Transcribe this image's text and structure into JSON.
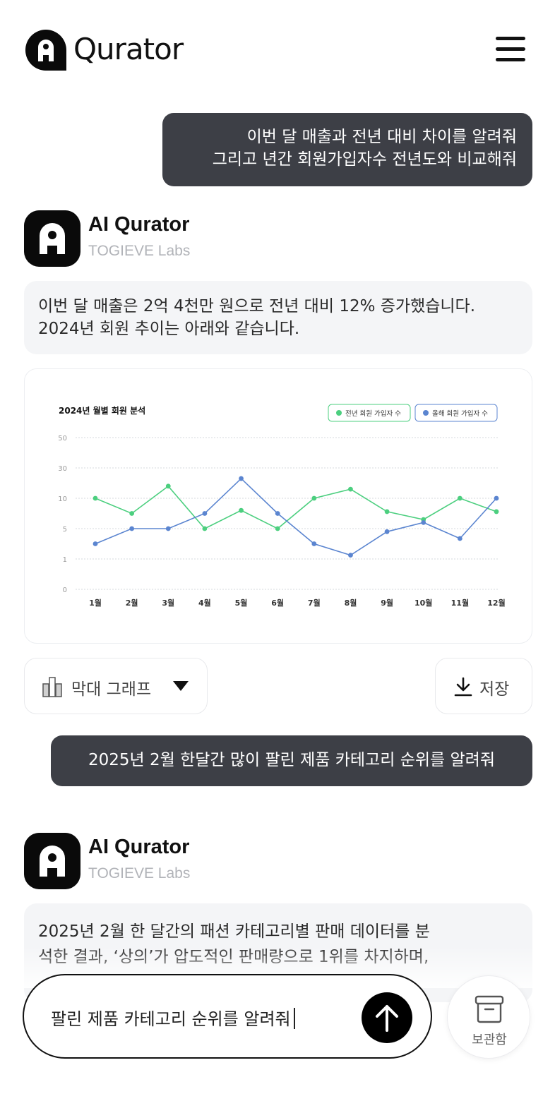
{
  "header": {
    "brand": "Qurator",
    "menu_icon": "hamburger-menu-icon"
  },
  "messages": [
    {
      "role": "user",
      "lines": [
        "이번 달 매출과 전년 대비 차이를 알려줘",
        "그리고 년간 회원가입자수 전년도와 비교해줘"
      ]
    },
    {
      "role": "ai",
      "name": "AI Qurator",
      "org": "TOGIEVE Labs",
      "lines": [
        "이번 달 매출은 2억 4천만 원으로 전년 대비 12% 증가했습니다.",
        "2024년 회원 추이는 아래와 같습니다."
      ]
    },
    {
      "role": "user",
      "lines": [
        "2025년 2월 한달간 많이 팔린 제품 카테고리 순위를 알려줘"
      ]
    },
    {
      "role": "ai",
      "name": "AI Qurator",
      "org": "TOGIEVE Labs",
      "lines": [
        "2025년 2월 한 달간의 패션 카테고리별 판매 데이터를 분",
        "석한 결과, ‘상의’가 압도적인 판매량으로 1위를 차지하며,"
      ]
    }
  ],
  "chart_controls": {
    "type_label": "막대 그래프",
    "type_icon": "bar-chart-icon",
    "save_label": "저장",
    "save_icon": "download-icon"
  },
  "input": {
    "value": "팔린 제품 카테고리 순위를 알려줘",
    "send_icon": "arrow-up-icon"
  },
  "archive": {
    "label": "보관함",
    "icon": "archive-box-icon"
  },
  "colors": {
    "user_bubble": "#3d3f46",
    "ai_bubble": "#f4f5f7",
    "series_prev": "#4ccf7f",
    "series_curr": "#5b85d0"
  },
  "chart_data": {
    "type": "line",
    "title": "2024년 월별 회원 분석",
    "categories": [
      "1월",
      "2월",
      "3월",
      "4월",
      "5월",
      "6월",
      "7월",
      "8월",
      "9월",
      "10월",
      "11월",
      "12월"
    ],
    "y_ticks": [
      0,
      1,
      5,
      10,
      30,
      50
    ],
    "legend_position": "top-right",
    "grid": true,
    "series": [
      {
        "name": "전년 회원 가입자 수",
        "color": "#4ccf7f",
        "values": [
          10,
          7.5,
          18,
          5,
          8,
          5,
          10,
          16,
          7.8,
          6.5,
          10,
          7.8
        ]
      },
      {
        "name": "올해 회원 가입자 수",
        "color": "#5b85d0",
        "values": [
          3,
          5,
          5,
          7.5,
          23,
          7.5,
          3,
          1.5,
          4.6,
          6,
          3.7,
          10
        ]
      }
    ]
  }
}
